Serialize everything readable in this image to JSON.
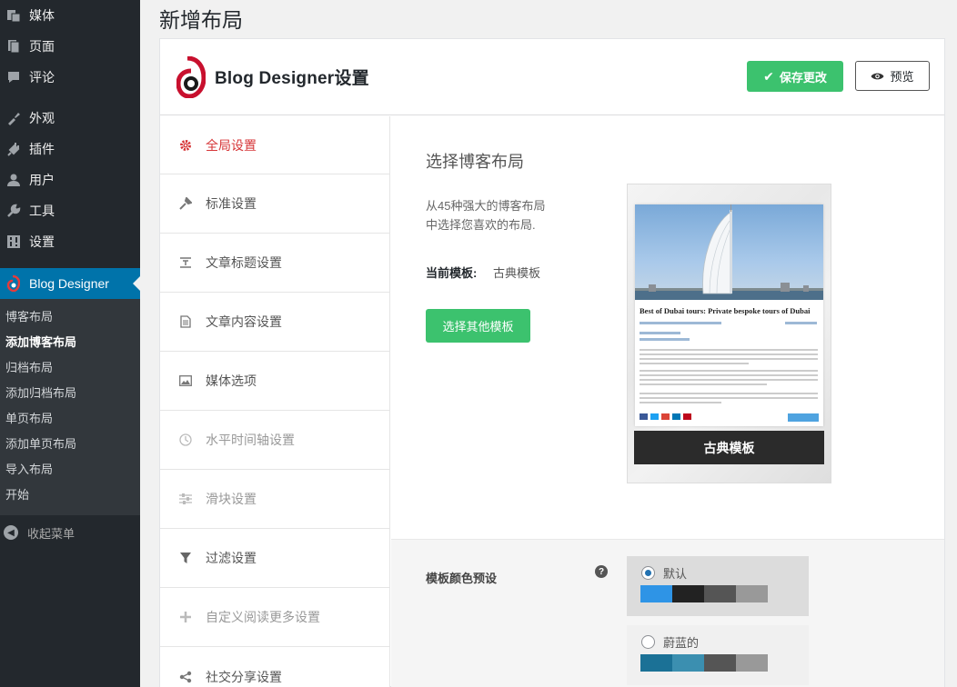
{
  "admin_menu": {
    "items": [
      {
        "label": "媒体",
        "icon": "media-icon"
      },
      {
        "label": "页面",
        "icon": "pages-icon"
      },
      {
        "label": "评论",
        "icon": "comments-icon"
      },
      {
        "label": "外观",
        "icon": "appearance-icon"
      },
      {
        "label": "插件",
        "icon": "plugins-icon"
      },
      {
        "label": "用户",
        "icon": "users-icon"
      },
      {
        "label": "工具",
        "icon": "tools-icon"
      },
      {
        "label": "设置",
        "icon": "settings-icon"
      }
    ],
    "active": {
      "label": "Blog Designer",
      "icon": "blog-designer-icon"
    },
    "submenu": [
      "博客布局",
      "添加博客布局",
      "归档布局",
      "添加归档布局",
      "单页布局",
      "添加单页布局",
      "导入布局",
      "开始"
    ],
    "submenu_current": 1,
    "collapse_label": "收起菜单"
  },
  "page": {
    "title": "新增布局"
  },
  "header": {
    "brand_title": "Blog Designer设置",
    "save_label": "保存更改",
    "preview_label": "预览"
  },
  "settings_nav": [
    {
      "label": "全局设置",
      "icon": "gear-icon"
    },
    {
      "label": "标准设置",
      "icon": "wrench-icon"
    },
    {
      "label": "文章标题设置",
      "icon": "title-icon"
    },
    {
      "label": "文章内容设置",
      "icon": "document-icon"
    },
    {
      "label": "媒体选项",
      "icon": "image-icon"
    },
    {
      "label": "水平时间轴设置",
      "icon": "clock-icon"
    },
    {
      "label": "滑块设置",
      "icon": "sliders-icon"
    },
    {
      "label": "过滤设置",
      "icon": "filter-icon"
    },
    {
      "label": "自定义阅读更多设置",
      "icon": "plus-icon"
    },
    {
      "label": "社交分享设置",
      "icon": "share-icon"
    }
  ],
  "layout": {
    "section_title": "选择博客布局",
    "desc_line1": "从45种强大的博客布局",
    "desc_line2": "中选择您喜欢的布局.",
    "current_label": "当前模板:",
    "current_value": "古典模板",
    "choose_button": "选择其他模板",
    "preview_card": {
      "post_title": "Best of Dubai tours: Private bespoke tours of Dubai",
      "template_name": "古典模板"
    }
  },
  "preset": {
    "label": "模板颜色预设",
    "help": "?",
    "options": [
      {
        "name": "默认",
        "selected": true,
        "colors": [
          "#2e94e6",
          "#222222",
          "#555555",
          "#999999"
        ]
      },
      {
        "name": "蔚蓝的",
        "selected": false,
        "colors": [
          "#1b7196",
          "#3b8fb0",
          "#555555",
          "#999999"
        ]
      }
    ]
  },
  "colors": {
    "sidebar_bg": "#23282d",
    "active_blue": "#0073aa",
    "accent_green": "#3cc26e",
    "accent_red": "#d63638"
  }
}
